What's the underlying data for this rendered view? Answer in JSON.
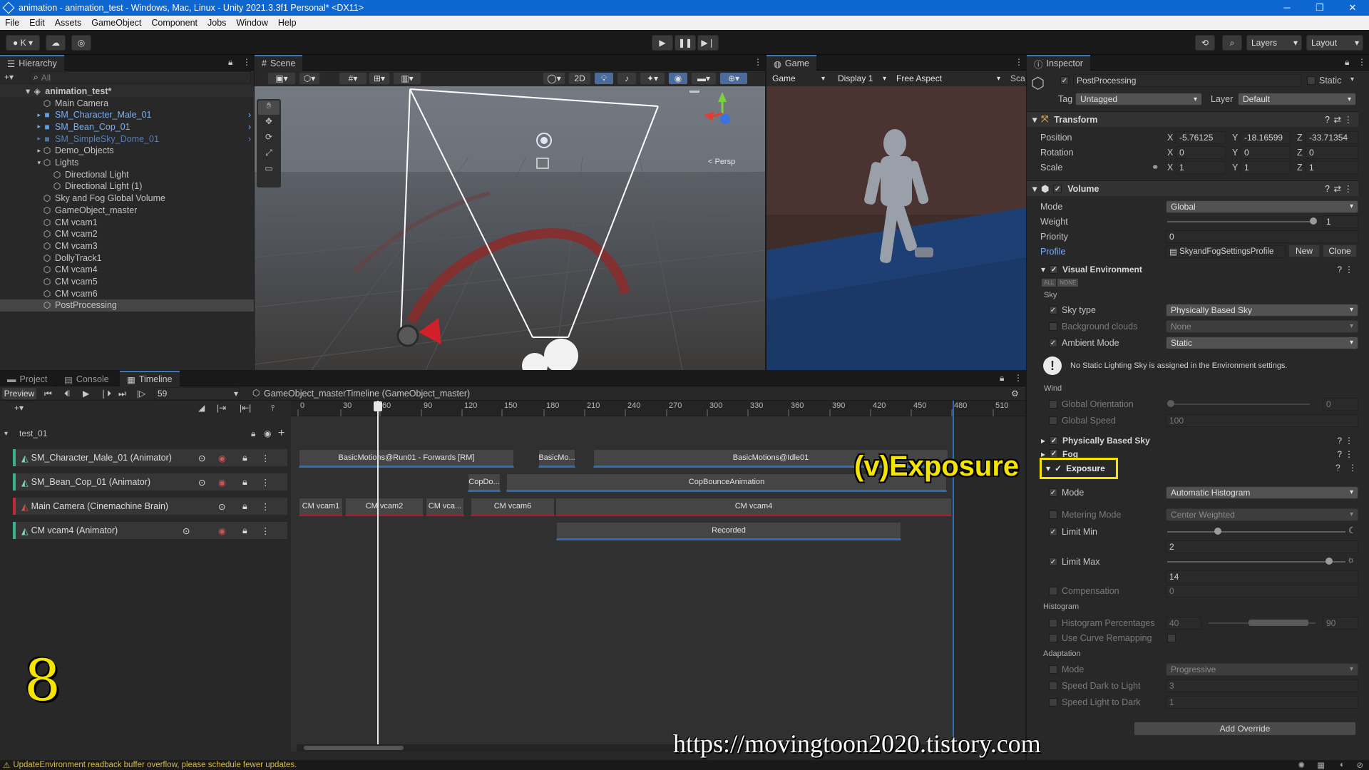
{
  "window": {
    "title": "animation - animation_test - Windows, Mac, Linux - Unity 2021.3.3f1 Personal* <DX11>",
    "controls": [
      "─",
      "❐",
      "✕"
    ]
  },
  "menu": [
    "File",
    "Edit",
    "Assets",
    "GameObject",
    "Component",
    "Jobs",
    "Window",
    "Help"
  ],
  "toolbar": {
    "account": "K",
    "layers": "Layers",
    "layout": "Layout"
  },
  "hierarchy": {
    "tab": "Hierarchy",
    "search_placeholder": "All",
    "scene": "animation_test*",
    "items": [
      {
        "label": "Main Camera",
        "indent": 1,
        "kind": "normal"
      },
      {
        "label": "SM_Character_Male_01",
        "indent": 1,
        "kind": "prefab"
      },
      {
        "label": "SM_Bean_Cop_01",
        "indent": 1,
        "kind": "prefab"
      },
      {
        "label": "SM_SimpleSky_Dome_01",
        "indent": 1,
        "kind": "prefab-dim"
      },
      {
        "label": "Demo_Objects",
        "indent": 1,
        "kind": "normal"
      },
      {
        "label": "Lights",
        "indent": 1,
        "kind": "normal"
      },
      {
        "label": "Directional Light",
        "indent": 2,
        "kind": "normal"
      },
      {
        "label": "Directional Light (1)",
        "indent": 2,
        "kind": "normal"
      },
      {
        "label": "Sky and Fog Global Volume",
        "indent": 1,
        "kind": "normal"
      },
      {
        "label": "GameObject_master",
        "indent": 1,
        "kind": "normal"
      },
      {
        "label": "CM vcam1",
        "indent": 1,
        "kind": "normal"
      },
      {
        "label": "CM vcam2",
        "indent": 1,
        "kind": "normal"
      },
      {
        "label": "CM vcam3",
        "indent": 1,
        "kind": "normal"
      },
      {
        "label": "DollyTrack1",
        "indent": 1,
        "kind": "normal"
      },
      {
        "label": "CM vcam4",
        "indent": 1,
        "kind": "normal"
      },
      {
        "label": "CM vcam5",
        "indent": 1,
        "kind": "normal"
      },
      {
        "label": "CM vcam6",
        "indent": 1,
        "kind": "normal"
      },
      {
        "label": "PostProcessing",
        "indent": 1,
        "kind": "selected"
      }
    ]
  },
  "scene": {
    "tab": "Scene",
    "mode_2d": "2D",
    "persp": "< Persp"
  },
  "game": {
    "tab": "Game",
    "view": "Game",
    "display": "Display 1",
    "aspect": "Free Aspect",
    "scale": "Sca"
  },
  "bottom_tabs": [
    "Project",
    "Console",
    "Timeline"
  ],
  "timeline": {
    "preview": "Preview",
    "frame": "59",
    "asset": "GameObject_masterTimeline (GameObject_master)",
    "group": "test_01",
    "ruler": [
      "0",
      "30",
      "60",
      "90",
      "120",
      "150",
      "180",
      "210",
      "240",
      "270",
      "300",
      "330",
      "360",
      "390",
      "420",
      "450",
      "480",
      "510"
    ],
    "tracks": [
      {
        "label": "SM_Character_Male_01 (Animator)"
      },
      {
        "label": "SM_Bean_Cop_01 (Animator)"
      },
      {
        "label": "Main Camera (Cinemachine Brain)"
      },
      {
        "label": "CM vcam4 (Animator)"
      }
    ],
    "clips": {
      "run": "BasicMotions@Run01 - Forwards [RM]",
      "basicmo": "BasicMo...",
      "idle": "BasicMotions@Idle01",
      "copdo": "CopDo...",
      "copbounce": "CopBounceAnimation",
      "vcam1": "CM vcam1",
      "vcam2": "CM vcam2",
      "vca": "CM vca...",
      "vcam6": "CM vcam6",
      "vcam4": "CM vcam4",
      "recorded": "Recorded"
    }
  },
  "inspector": {
    "tab": "Inspector",
    "object_name": "PostProcessing",
    "static": "Static",
    "tag_label": "Tag",
    "tag": "Untagged",
    "layer_label": "Layer",
    "layer": "Default",
    "transform": {
      "title": "Transform",
      "position_label": "Position",
      "rotation_label": "Rotation",
      "scale_label": "Scale",
      "position": {
        "x": "-5.76125",
        "y": "-18.16599",
        "z": "-33.71354"
      },
      "rotation": {
        "x": "0",
        "y": "0",
        "z": "0"
      },
      "scale": {
        "x": "1",
        "y": "1",
        "z": "1"
      }
    },
    "volume": {
      "title": "Volume",
      "mode_label": "Mode",
      "mode": "Global",
      "weight_label": "Weight",
      "weight": "1",
      "priority_label": "Priority",
      "priority": "0",
      "profile_label": "Profile",
      "profile": "SkyandFogSettingsProfile",
      "new": "New",
      "clone": "Clone"
    },
    "visual_env": {
      "title": "Visual Environment",
      "all": "ALL",
      "none": "NONE",
      "sky_label": "Sky",
      "sky_type_label": "Sky type",
      "sky_type": "Physically Based Sky",
      "bg_clouds_label": "Background clouds",
      "bg_clouds": "None",
      "ambient_label": "Ambient Mode",
      "ambient": "Static",
      "warning": "No Static Lighting Sky is assigned in the Environment settings.",
      "wind_label": "Wind",
      "global_orientation_label": "Global Orientation",
      "global_orientation": "0",
      "global_speed_label": "Global Speed",
      "global_speed": "100"
    },
    "pbs_title": "Physically Based Sky",
    "fog_title": "Fog",
    "exposure": {
      "title": "Exposure",
      "mode_label": "Mode",
      "mode": "Automatic Histogram",
      "metering_label": "Metering Mode",
      "metering": "Center Weighted",
      "limit_min_label": "Limit Min",
      "limit_min": "2",
      "limit_max_label": "Limit Max",
      "limit_max": "14",
      "compensation_label": "Compensation",
      "compensation": "0",
      "histogram_label": "Histogram",
      "hist_pct_label": "Histogram Percentages",
      "hist_low": "40",
      "hist_high": "90",
      "curve_label": "Use Curve Remapping",
      "adaptation_label": "Adaptation",
      "adapt_mode_label": "Mode",
      "adapt_mode": "Progressive",
      "dark_light_label": "Speed Dark to Light",
      "dark_light": "3",
      "light_dark_label": "Speed Light to Dark",
      "light_dark": "1"
    },
    "add_override": "Add Override"
  },
  "overlay": {
    "caption": "(v)Exposure",
    "step": "8",
    "url": "https://movingtoon2020.tistory.com"
  },
  "status": {
    "message": "UpdateEnvironment readback buffer overflow, please schedule fewer updates."
  }
}
